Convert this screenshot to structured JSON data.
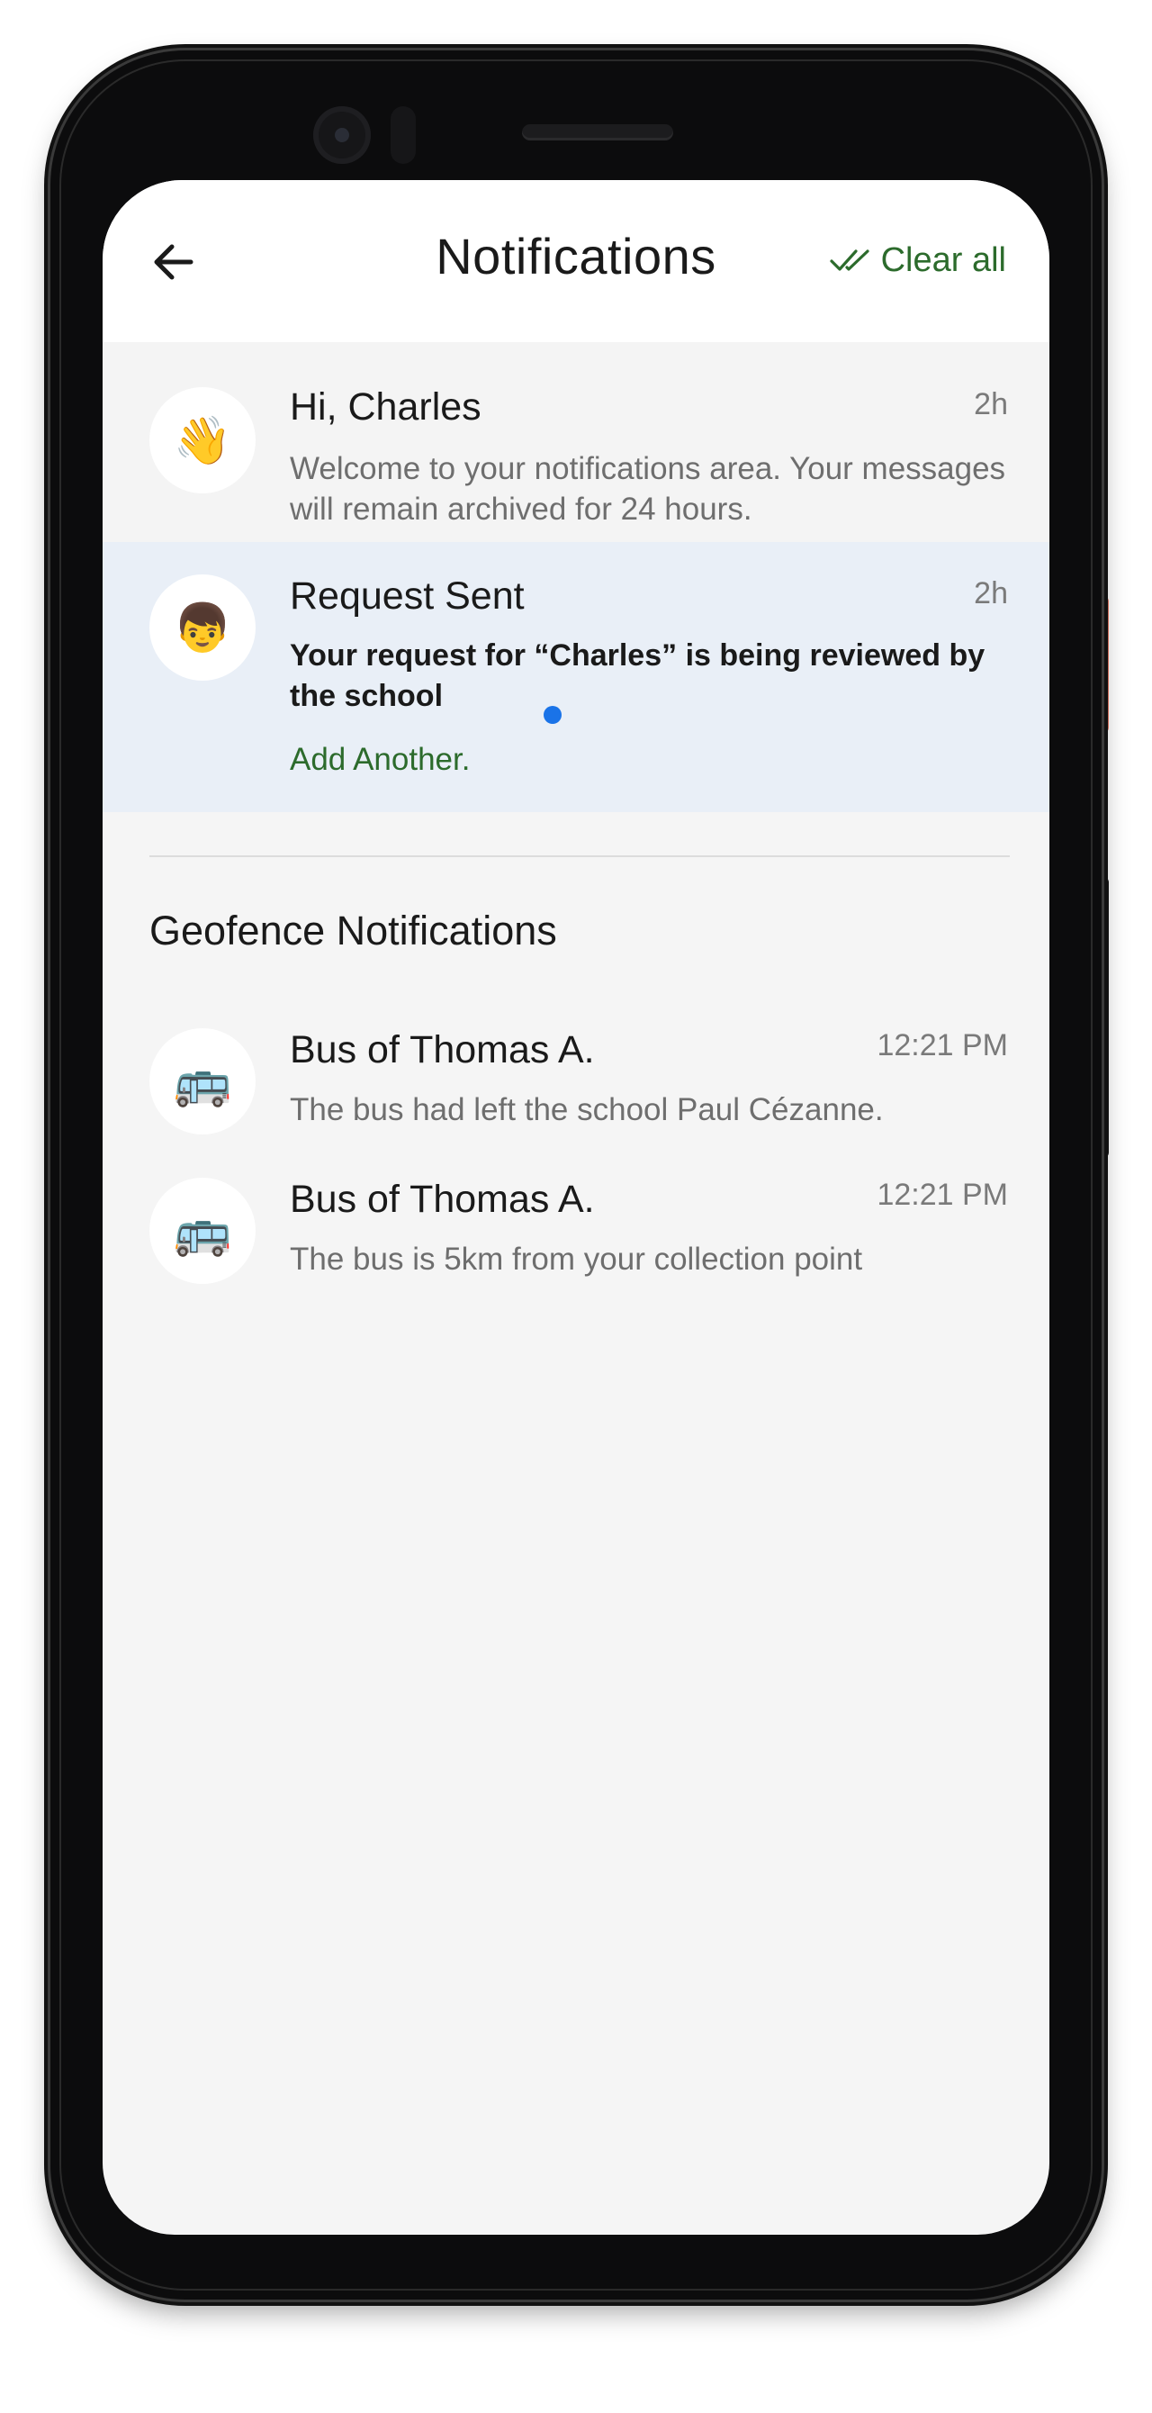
{
  "header": {
    "title": "Notifications",
    "clear_all_label": "Clear all",
    "back_icon": "arrow-left-icon",
    "clear_icon": "double-check-icon"
  },
  "notifications": [
    {
      "avatar_emoji": "👋",
      "avatar_icon": "waving-hand-icon",
      "title": "Hi, Charles",
      "time": "2h",
      "body": "Welcome to your notifications area. Your messages will remain archived for 24 hours."
    },
    {
      "avatar_emoji": "👦",
      "avatar_icon": "child-face-icon",
      "title": "Request Sent",
      "time": "2h",
      "body": "Your request for “Charles” is being reviewed by the school",
      "action_label": "Add Another.",
      "unread": true
    }
  ],
  "geofence": {
    "section_title": "Geofence Notifications",
    "items": [
      {
        "avatar_emoji": "🚌",
        "avatar_icon": "bus-icon",
        "title": "Bus of Thomas A.",
        "time": "12:21 PM",
        "body": "The bus had left the school Paul Cézanne."
      },
      {
        "avatar_emoji": "🚌",
        "avatar_icon": "bus-icon",
        "title": "Bus of Thomas A.",
        "time": "12:21 PM",
        "body": "The bus is 5km from your collection point"
      }
    ]
  },
  "colors": {
    "accent_green": "#2c6b2c",
    "unread_dot": "#1a73e8",
    "highlight_row": "#e9eff7",
    "screen_bg": "#f5f5f5"
  }
}
